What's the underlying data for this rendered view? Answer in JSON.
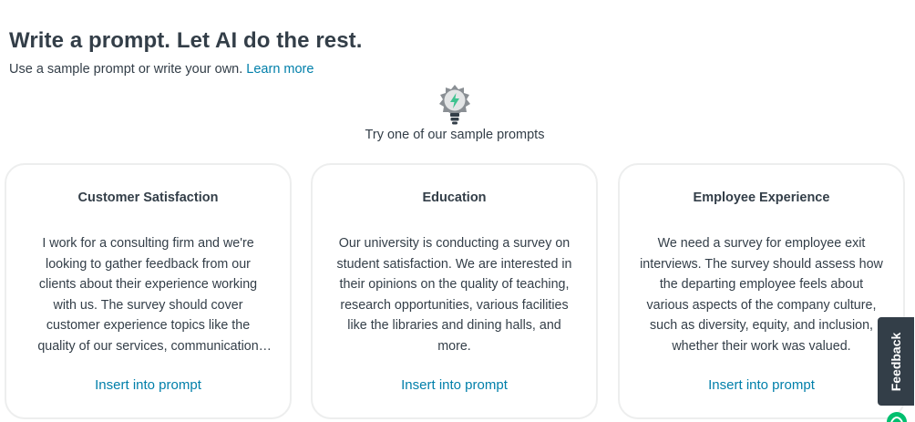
{
  "header": {
    "title": "Write a prompt. Let AI do the rest.",
    "subtitle": "Use a sample prompt or write your own.",
    "learn_more": "Learn more"
  },
  "samples": {
    "icon": "lightbulb-icon",
    "heading": "Try one of our sample prompts",
    "cards": [
      {
        "title": "Customer Satisfaction",
        "body": "I work for a consulting firm and we're looking to gather feedback from our clients about their experience working with us. The survey should cover customer experience topics like the quality of our services, communication and responsiveness.",
        "action": "Insert into prompt"
      },
      {
        "title": "Education",
        "body": "Our university is conducting a survey on student satisfaction. We are interested in their opinions on the quality of teaching, research opportunities, various facilities like the libraries and dining halls, and more.",
        "action": "Insert into prompt"
      },
      {
        "title": "Employee Experience",
        "body": "We need a survey for employee exit interviews. The survey should assess how the departing employee feels about various aspects of the company culture, such as diversity, equity, and inclusion, whether their work was valued.",
        "action": "Insert into prompt"
      }
    ]
  },
  "feedback": {
    "label": "Feedback"
  },
  "colors": {
    "text": "#333e48",
    "link": "#007faa",
    "card_border": "#edeeee",
    "feedback_bg": "#333e48",
    "brand_green": "#00bf6f"
  }
}
